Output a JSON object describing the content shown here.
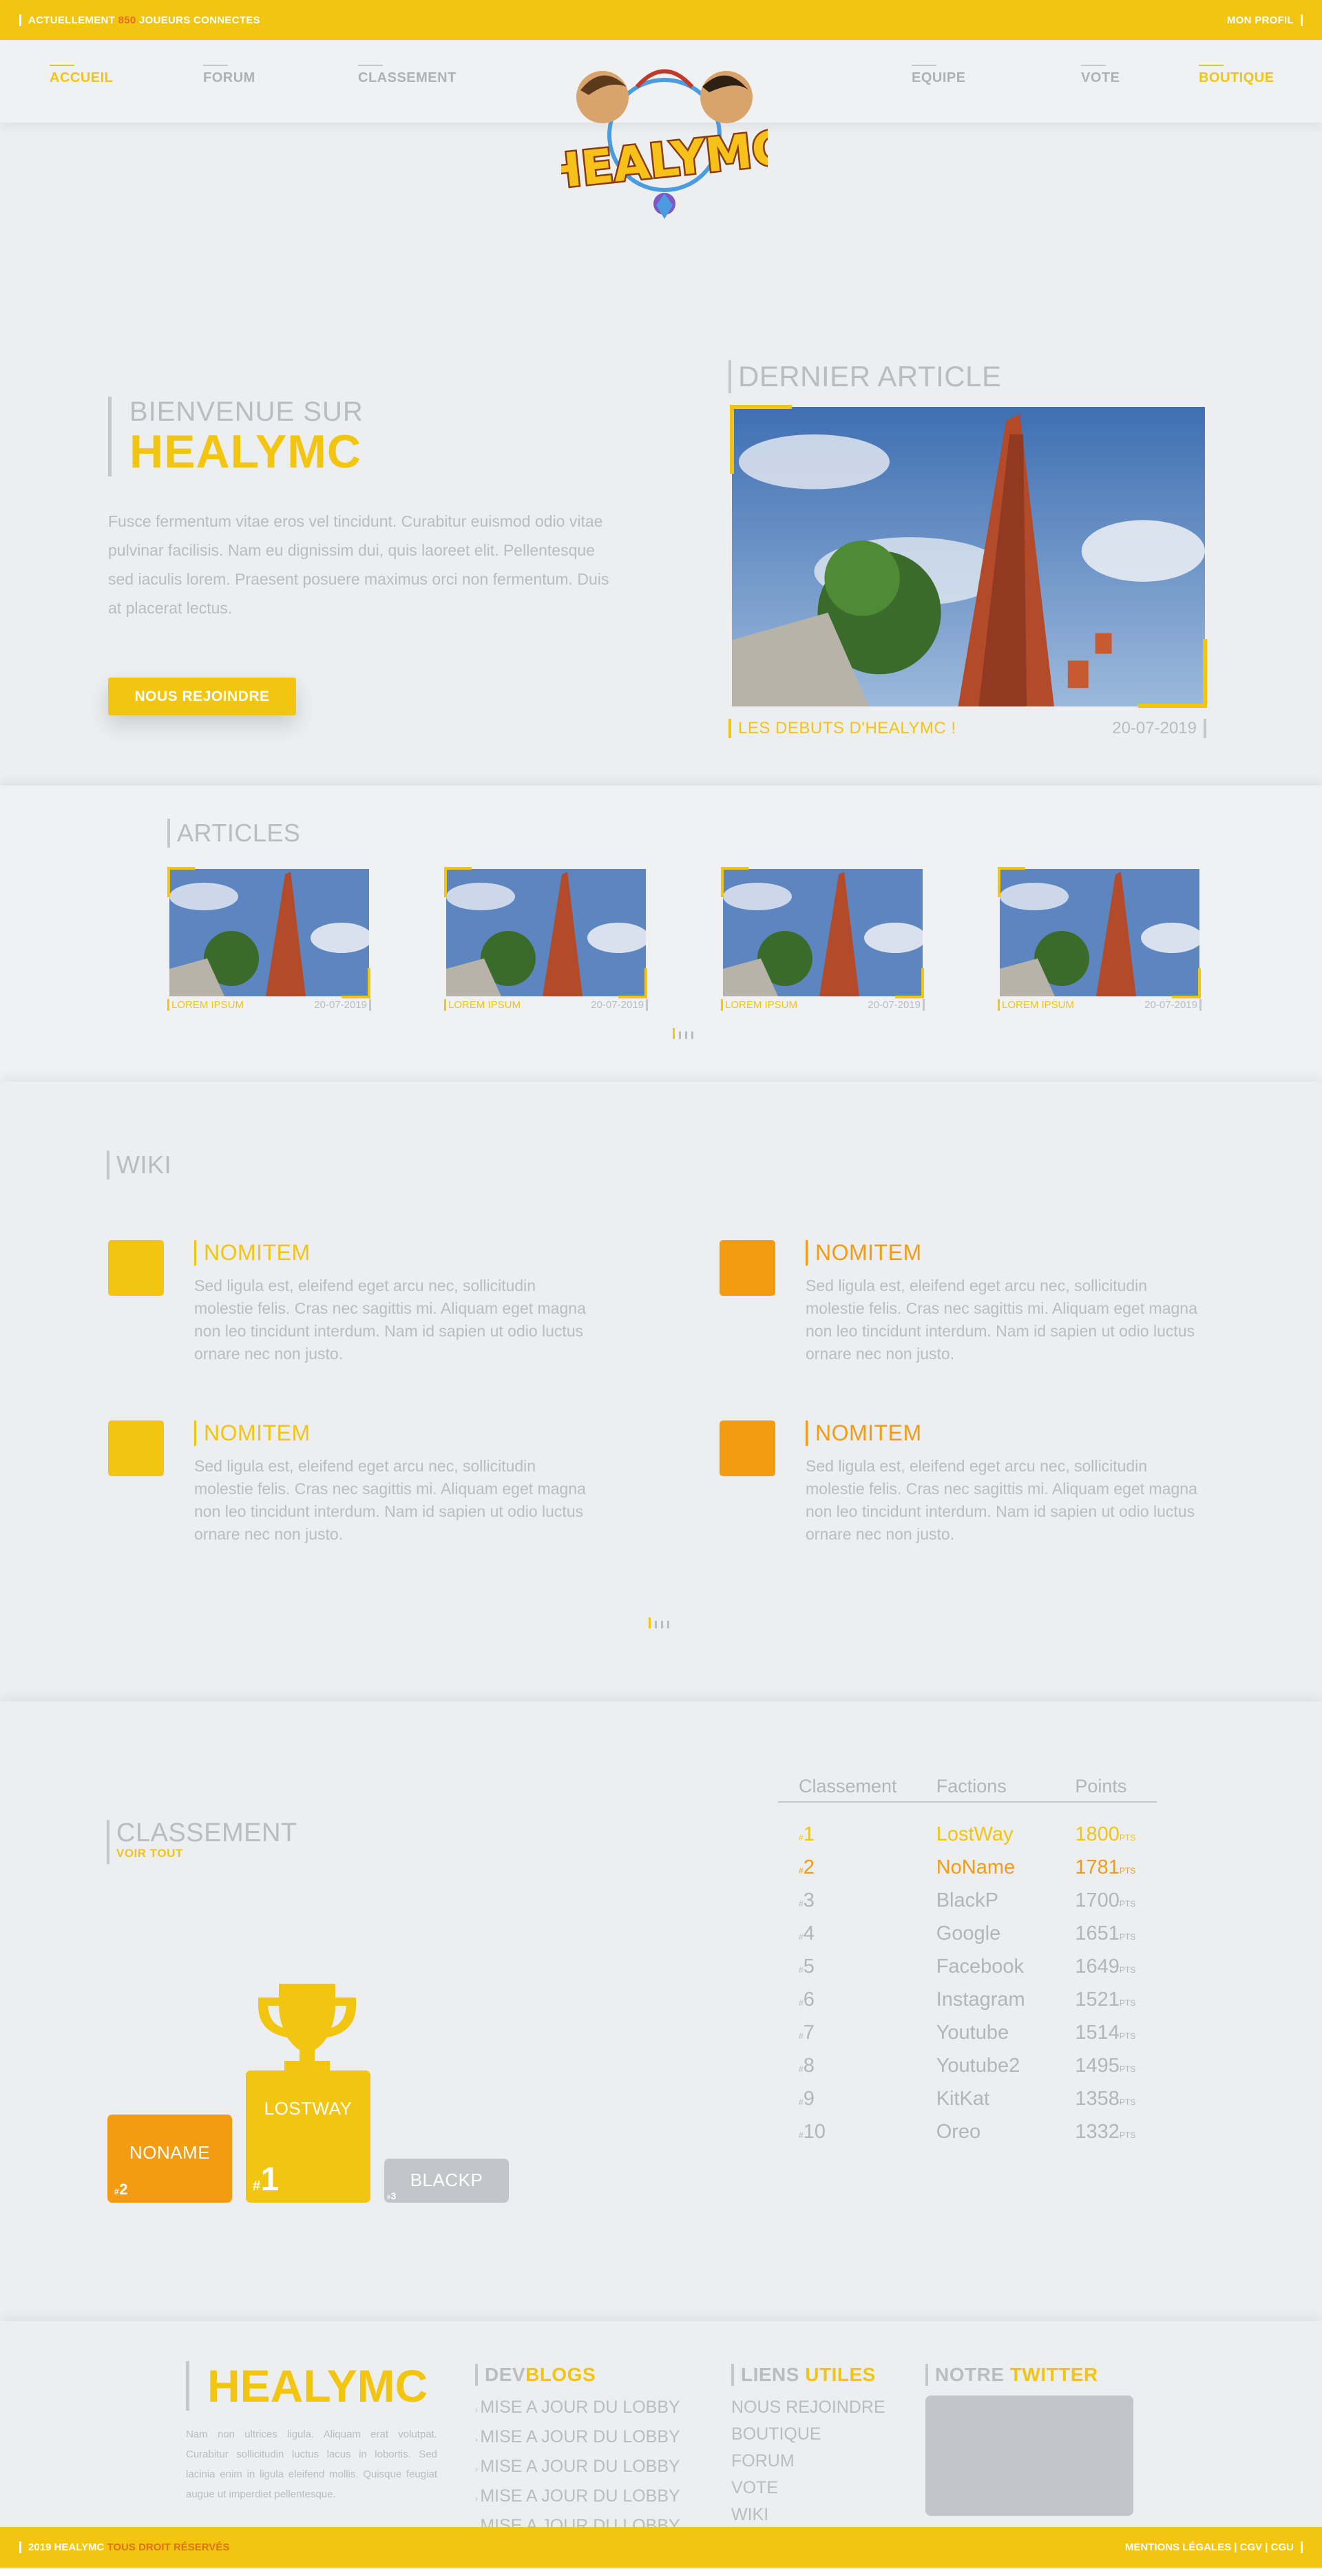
{
  "topbar": {
    "prefix": "ACTUELLEMENT",
    "count": "850",
    "suffix": "JOUEURS CONNECTES",
    "profile": "MON PROFIL"
  },
  "nav": {
    "left": [
      "ACCUEIL",
      "FORUM",
      "CLASSEMENT"
    ],
    "right": [
      "EQUIPE",
      "VOTE",
      "BOUTIQUE"
    ],
    "logo_text": "HEALYMC"
  },
  "hero": {
    "welcome": "BIENVENUE SUR",
    "brand": "HEALYMC",
    "description": "Fusce fermentum vitae eros vel tincidunt. Curabitur euismod odio vitae pulvinar facilisis. Nam eu dignissim dui, quis laoreet elit. Pellentesque sed iaculis lorem. Praesent posuere maximus orci non fermentum. Duis at placerat lectus.",
    "join_button": "NOUS REJOINDRE"
  },
  "latest": {
    "heading": "DERNIER ARTICLE",
    "title": "LES DEBUTS D'HEALYMC !",
    "date": "20-07-2019"
  },
  "articles": {
    "heading": "ARTICLES",
    "items": [
      {
        "title": "LOREM IPSUM",
        "date": "20-07-2019"
      },
      {
        "title": "LOREM IPSUM",
        "date": "20-07-2019"
      },
      {
        "title": "LOREM IPSUM",
        "date": "20-07-2019"
      },
      {
        "title": "LOREM IPSUM",
        "date": "20-07-2019"
      }
    ]
  },
  "wiki": {
    "heading": "WIKI",
    "items": [
      {
        "title": "NOMITEM",
        "text": "Sed ligula est, eleifend eget arcu nec, sollicitudin molestie felis. Cras nec sagittis mi. Aliquam eget magna non leo tincidunt interdum. Nam id sapien ut odio luctus ornare nec non justo.",
        "color": "#f2c510"
      },
      {
        "title": "NOMITEM",
        "text": "Sed ligula est, eleifend eget arcu nec, sollicitudin molestie felis. Cras nec sagittis mi. Aliquam eget magna non leo tincidunt interdum. Nam id sapien ut odio luctus ornare nec non justo.",
        "color": "#f39c12"
      },
      {
        "title": "NOMITEM",
        "text": "Sed ligula est, eleifend eget arcu nec, sollicitudin molestie felis. Cras nec sagittis mi. Aliquam eget magna non leo tincidunt interdum. Nam id sapien ut odio luctus ornare nec non justo.",
        "color": "#f2c510"
      },
      {
        "title": "NOMITEM",
        "text": "Sed ligula est, eleifend eget arcu nec, sollicitudin molestie felis. Cras nec sagittis mi. Aliquam eget magna non leo tincidunt interdum. Nam id sapien ut odio luctus ornare nec non justo.",
        "color": "#f39c12"
      }
    ]
  },
  "ranking": {
    "heading": "CLASSEMENT",
    "see_all": "VOIR TOUT",
    "podium": [
      {
        "name": "NONAME",
        "rank": "2"
      },
      {
        "name": "LOSTWAY",
        "rank": "1"
      },
      {
        "name": "BLACKP",
        "rank": "3"
      }
    ],
    "columns": [
      "Classement",
      "Factions",
      "Points"
    ],
    "pts_unit": "PTS",
    "rows": [
      {
        "rank": "1",
        "faction": "LostWay",
        "points": "1800"
      },
      {
        "rank": "2",
        "faction": "NoName",
        "points": "1781"
      },
      {
        "rank": "3",
        "faction": "BlackP",
        "points": "1700"
      },
      {
        "rank": "4",
        "faction": "Google",
        "points": "1651"
      },
      {
        "rank": "5",
        "faction": "Facebook",
        "points": "1649"
      },
      {
        "rank": "6",
        "faction": "Instagram",
        "points": "1521"
      },
      {
        "rank": "7",
        "faction": "Youtube",
        "points": "1514"
      },
      {
        "rank": "8",
        "faction": "Youtube2",
        "points": "1495"
      },
      {
        "rank": "9",
        "faction": "KitKat",
        "points": "1358"
      },
      {
        "rank": "10",
        "faction": "Oreo",
        "points": "1332"
      }
    ]
  },
  "footer": {
    "brand": "HEALYMC",
    "about": "Nam non ultrices ligula. Aliquam erat volutpat. Curabitur sollicitudin luctus lacus in lobortis. Sed lacinia enim in ligula eleifend mollis. Quisque feugiat augue ut imperdiet pellentesque.",
    "devblogs_a": "DEV",
    "devblogs_b": "BLOGS",
    "devblogs": [
      "MISE A JOUR DU LOBBY",
      "MISE A JOUR DU LOBBY",
      "MISE A JOUR DU LOBBY",
      "MISE A JOUR DU LOBBY",
      "MISE A JOUR DU LOBBY"
    ],
    "links_a": "LIENS",
    "links_b": "UTILES",
    "links": [
      "NOUS REJOINDRE",
      "BOUTIQUE",
      "FORUM",
      "VOTE",
      "WIKI"
    ],
    "twitter_a": "NOTRE",
    "twitter_b": "TWITTER"
  },
  "bottombar": {
    "year_brand": "2019 HEALYMC",
    "rights": "TOUS DROIT RÉSERVÉS",
    "legal": "MENTIONS LÉGALES | CGV | CGU"
  }
}
